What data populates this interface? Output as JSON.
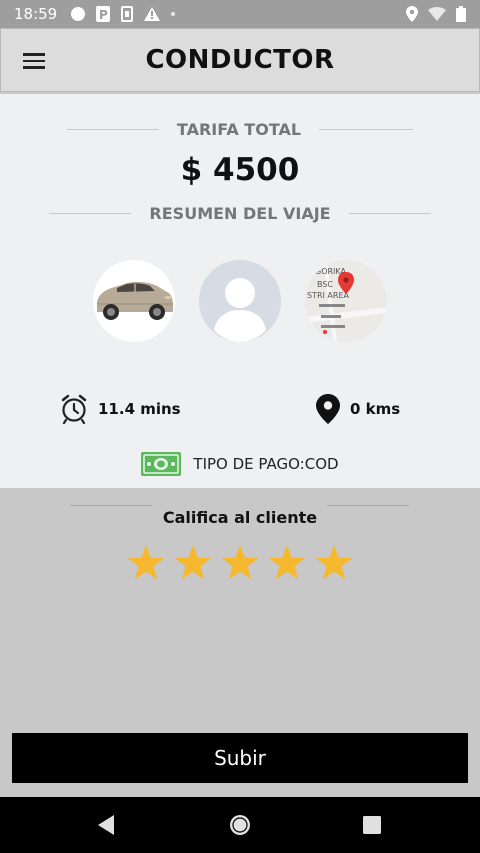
{
  "status_bar": {
    "time": "18:59",
    "icons": [
      "circle-icon",
      "parking-icon",
      "sim-icon",
      "warning-icon",
      "dot-icon",
      "location-icon",
      "wifi-icon",
      "battery-icon"
    ]
  },
  "app_bar": {
    "title": "CONDUCTOR",
    "menu_icon": "hamburger-menu-icon"
  },
  "summary": {
    "fare_title": "TARIFA TOTAL",
    "fare_amount": "$ 4500",
    "trip_title": "RESUMEN DEL VIAJE",
    "time_value": "11.4 mins",
    "distance_value": "0 kms",
    "payment_text": "TIPO DE PAGO:COD"
  },
  "rating": {
    "title": "Califica al cliente",
    "stars": 5,
    "filled": 5,
    "star_color": "#f5b82e"
  },
  "submit": {
    "label": "Subir"
  },
  "colors": {
    "summary_bg": "#eff0f2",
    "page_bg": "#c8c8c8",
    "app_bar_bg": "#dcdcdc",
    "button_bg": "#000000"
  }
}
